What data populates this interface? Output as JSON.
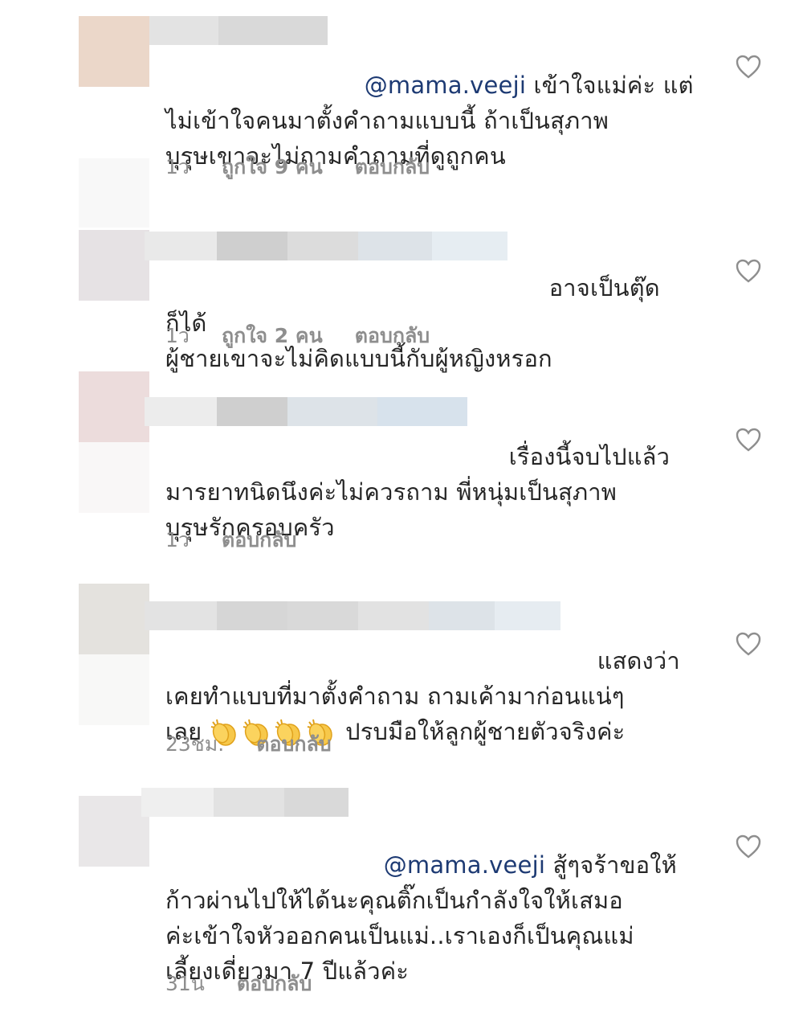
{
  "comments": [
    {
      "mention": "@mama.veeji",
      "first_line": " เข้าใจแม่ค่ะ แต่",
      "rest": "ไม่เข้าใจคนมาตั้งคำถามแบบนี้ ถ้าเป็นสุภาพ\nบุรุษเขาจะไม่ถามคำถามที่ดูถูกคน",
      "time": "1ว",
      "likes": "ถูกใจ 9 คน",
      "reply": "ตอบกลับ",
      "avatar_color": "#ebd7c9"
    },
    {
      "mention": "",
      "first_line": "อาจเป็นตุ๊ดก็ได้",
      "rest": "ผู้ชายเขาจะไม่คิดแบบนี้กับผู้หญิงหรอก",
      "time": "1ว",
      "likes": "ถูกใจ 2 คน",
      "reply": "ตอบกลับ",
      "avatar_color": "#e6e2e4"
    },
    {
      "mention": "",
      "first_line": "เรื่องนี้จบไปแล้ว",
      "rest": "มารยาทนิดนึงค่ะไม่ควรถาม พี่หนุ่มเป็นสุภาพ\nบุรุษรักครอบครัว",
      "time": "1ว",
      "likes": "",
      "reply": "ตอบกลับ",
      "avatar_color": "#ecdcdc"
    },
    {
      "mention": "",
      "first_line": "แสดงว่า",
      "line2": "เคยทำแบบที่มาตั้งคำถาม ถามเค้ามาก่อนแน่ๆ",
      "line3_prefix": "เลย ",
      "line3_suffix": " ปรบมือให้ลูกผู้ชายตัวจริงค่ะ",
      "time": "23ชม.",
      "likes": "",
      "reply": "ตอบกลับ",
      "avatar_color": "#e4e2de",
      "emoji": "clapping-hands"
    },
    {
      "mention": "@mama.veeji",
      "first_line": " สู้ๆจร้าขอให้",
      "rest": "ก้าวผ่านไปให้ได้นะคุณติ๊กเป็นกำลังใจให้เสมอ\nค่ะเข้าใจหัวออกคนเป็นแม่..เราเองก็เป็นคุณแม่\nเลี้ยงเดี่ยวมา 7 ปีแล้วค่ะ",
      "time": "31น",
      "likes": "",
      "reply": "ตอบกลับ",
      "avatar_color": "#e9e7e8"
    }
  ],
  "colors": {
    "mention": "#1d3a73",
    "meta": "#8e8e8e",
    "heart": "#8e8e8e"
  }
}
